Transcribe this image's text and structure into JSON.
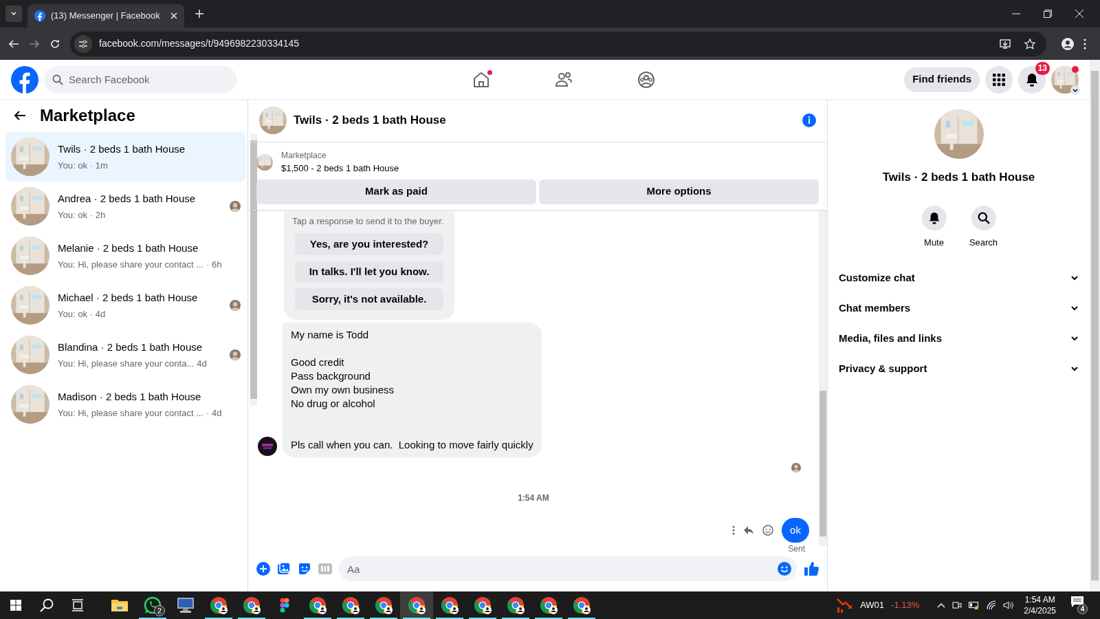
{
  "browser": {
    "tab_title": "(13) Messenger | Facebook",
    "url": "facebook.com/messages/t/9496982230334145"
  },
  "header": {
    "search_placeholder": "Search Facebook",
    "nav": [
      {
        "kind": "home",
        "notified": true
      },
      {
        "kind": "friends",
        "notified": false
      },
      {
        "kind": "groups",
        "notified": false
      }
    ],
    "find_friends": "Find friends",
    "notifications_count": "13",
    "profile_notified": true
  },
  "sidebar": {
    "title": "Marketplace",
    "conversations": [
      {
        "title": "Twils · 2 beds 1 bath House",
        "preview": "You: ok",
        "time": "· 1m",
        "selected": true,
        "seen": false
      },
      {
        "title": "Andrea · 2 beds 1 bath House",
        "preview": "You: ok",
        "time": "· 2h",
        "selected": false,
        "seen": true
      },
      {
        "title": "Melanie · 2 beds 1 bath House",
        "preview": "You: Hi, please share your contact ...",
        "time": "· 6h",
        "selected": false,
        "seen": false
      },
      {
        "title": "Michael · 2 beds 1 bath House",
        "preview": "You: ok",
        "time": "· 4d",
        "selected": false,
        "seen": true
      },
      {
        "title": "Blandina · 2 beds 1 bath House",
        "preview": "You: Hi, please share your conta...",
        "time": "4d",
        "selected": false,
        "seen": true
      },
      {
        "title": "Madison · 2 beds 1 bath House",
        "preview": "You: Hi, please share your contact ...",
        "time": "· 4d",
        "selected": false,
        "seen": false
      }
    ]
  },
  "chat": {
    "title": "Twils · 2 beds 1 bath House",
    "listing": {
      "label": "Marketplace",
      "text": "$1,500 - 2 beds 1 bath House"
    },
    "actions": [
      "Mark as paid",
      "More options"
    ],
    "quick_response": {
      "hint": "Tap a response to send it to the buyer.",
      "options": [
        "Yes, are you interested?",
        "In talks. I'll let you know.",
        "Sorry, it's not available."
      ]
    },
    "incoming": "My name is Todd\n\nGood credit\nPass background\nOwn my own business\nNo drug or alcohol\n\n\nPls call when you can.  Looking to move fairly quickly",
    "timestamp": "1:54 AM",
    "outgoing": "ok",
    "status": "Sent",
    "composer_placeholder": "Aa"
  },
  "details": {
    "name": "Twils · 2 beds 1 bath House",
    "actions": [
      {
        "kind": "mute",
        "label": "Mute"
      },
      {
        "kind": "search",
        "label": "Search"
      }
    ],
    "sections": [
      "Customize chat",
      "Chat members",
      "Media, files and links",
      "Privacy & support"
    ]
  },
  "taskbar": {
    "apps": [
      {
        "kind": "explorer",
        "running": false,
        "selected": false
      },
      {
        "kind": "whatsapp",
        "running": true,
        "selected": false,
        "badge": "2"
      },
      {
        "kind": "monitor",
        "running": false,
        "selected": false
      },
      {
        "kind": "chrome",
        "running": true,
        "selected": false
      },
      {
        "kind": "chrome",
        "running": true,
        "selected": false
      },
      {
        "kind": "figma",
        "running": false,
        "selected": false
      },
      {
        "kind": "chrome",
        "running": true,
        "selected": false
      },
      {
        "kind": "chrome",
        "running": true,
        "selected": false
      },
      {
        "kind": "chrome",
        "running": true,
        "selected": false
      },
      {
        "kind": "chrome",
        "running": true,
        "selected": true
      },
      {
        "kind": "chrome",
        "running": true,
        "selected": false
      },
      {
        "kind": "chrome",
        "running": true,
        "selected": false
      },
      {
        "kind": "chrome",
        "running": true,
        "selected": false
      },
      {
        "kind": "chrome",
        "running": true,
        "selected": false
      },
      {
        "kind": "chrome",
        "running": true,
        "selected": false
      }
    ],
    "ticker": "AW01",
    "change": "-1.13%",
    "time": "1:54 AM",
    "date": "2/4/2025",
    "notifications": "4"
  }
}
